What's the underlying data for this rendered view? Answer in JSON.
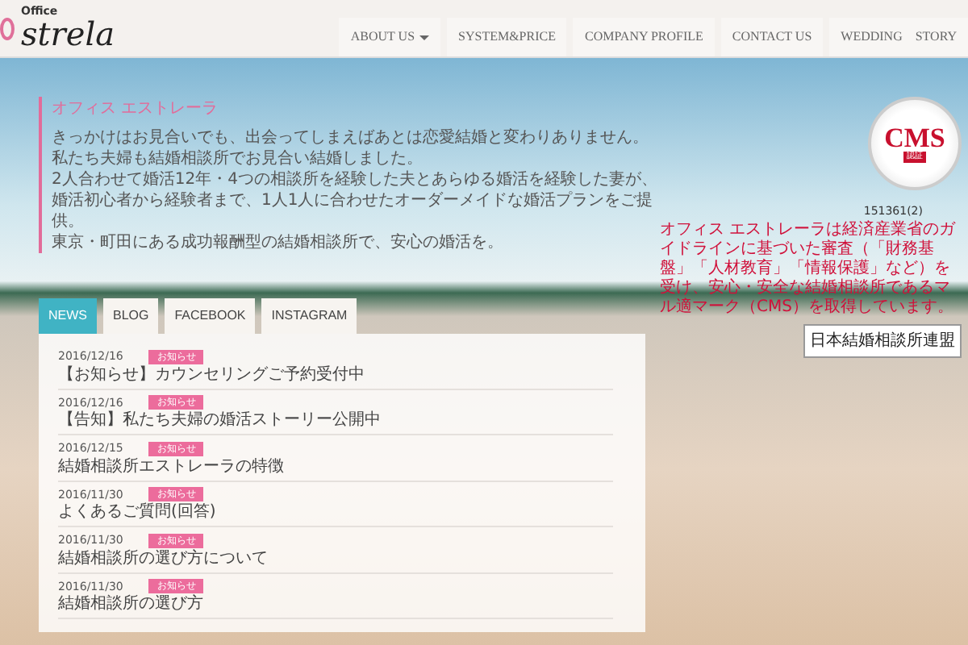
{
  "header": {
    "logo": {
      "small": "Office",
      "script": "strela"
    },
    "nav": [
      {
        "label": "ABOUT US",
        "dropdown": true
      },
      {
        "label": "SYSTEM&PRICE",
        "dropdown": false
      },
      {
        "label": "COMPANY PROFILE",
        "dropdown": false
      },
      {
        "label": "CONTACT US",
        "dropdown": false
      },
      {
        "label": "WEDDING　STORY",
        "dropdown": false
      }
    ]
  },
  "intro": {
    "title": "オフィス エストレーラ",
    "lines": [
      "きっかけはお見合いでも、出会ってしまえばあとは恋愛結婚と変わりありません。",
      "私たち夫婦も結婚相談所でお見合い結婚しました。",
      "2人合わせて婚活12年・4つの相談所を経験した夫とあらゆる婚活を経験した妻が、",
      "婚活初心者から経験者まで、1人1人に合わせたオーダーメイドな婚活プランをご提供。",
      "東京・町田にある成功報酬型の結婚相談所で、安心の婚活を。"
    ]
  },
  "certification": {
    "seal": {
      "mark": "CMS",
      "stamp": "認証"
    },
    "number": "151361(2)",
    "text": "オフィス エストレーラは経済産業省のガイドラインに基づいた審査（「財務基盤」「人材教育」「情報保護」など）を受け、安心・安全な結婚相談所であるマル適マーク（CMS）を取得しています。",
    "federation": "日本結婚相談所連盟"
  },
  "news": {
    "tabs": [
      {
        "label": "NEWS",
        "selected": true
      },
      {
        "label": "BLOG",
        "selected": false
      },
      {
        "label": "FACEBOOK",
        "selected": false
      },
      {
        "label": "INSTAGRAM",
        "selected": false
      }
    ],
    "items": [
      {
        "date": "2016/12/16",
        "tag": "お知らせ",
        "title": "【お知らせ】カウンセリングご予約受付中"
      },
      {
        "date": "2016/12/16",
        "tag": "お知らせ",
        "title": "【告知】私たち夫婦の婚活ストーリー公開中"
      },
      {
        "date": "2016/12/15",
        "tag": "お知らせ",
        "title": "結婚相談所エストレーラの特徴"
      },
      {
        "date": "2016/11/30",
        "tag": "お知らせ",
        "title": "よくあるご質問(回答)"
      },
      {
        "date": "2016/11/30",
        "tag": "お知らせ",
        "title": "結婚相談所の選び方について"
      },
      {
        "date": "2016/11/30",
        "tag": "お知らせ",
        "title": "結婚相談所の選び方"
      }
    ]
  }
}
